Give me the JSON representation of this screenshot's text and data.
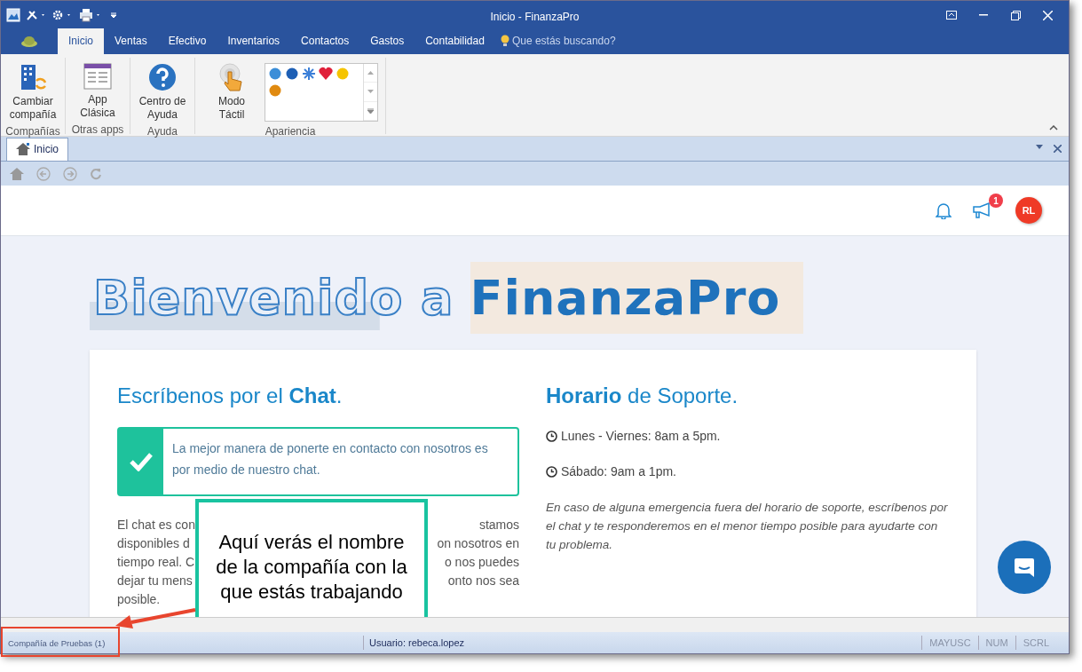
{
  "window": {
    "title": "Inicio - FinanzaPro"
  },
  "ribbon_tabs": [
    {
      "label": "Inicio",
      "selected": true
    },
    {
      "label": "Ventas",
      "selected": false
    },
    {
      "label": "Efectivo",
      "selected": false
    },
    {
      "label": "Inventarios",
      "selected": false
    },
    {
      "label": "Contactos",
      "selected": false
    },
    {
      "label": "Gastos",
      "selected": false
    },
    {
      "label": "Contabilidad",
      "selected": false
    }
  ],
  "search": {
    "placeholder": "Que estás buscando?"
  },
  "ribbon_groups": [
    {
      "label": "Compañías",
      "kind": "buttons",
      "buttons": [
        {
          "label": "Cambiar compañía",
          "kind": "building"
        }
      ]
    },
    {
      "label": "Otras apps",
      "kind": "buttons",
      "buttons": [
        {
          "label": "App Clásica",
          "kind": "window"
        }
      ]
    },
    {
      "label": "Ayuda",
      "kind": "buttons",
      "buttons": [
        {
          "label": "Centro de Ayuda",
          "kind": "help"
        }
      ]
    },
    {
      "label": "Apariencia",
      "kind": "gallery",
      "buttons": [
        {
          "label": "Modo Táctil",
          "kind": "touch"
        }
      ]
    }
  ],
  "document_tabs": [
    {
      "label": "Inicio",
      "selected": true
    }
  ],
  "header": {
    "notification_count": "1",
    "avatar_initials": "RL"
  },
  "welcome": {
    "lead": "Bienvenido a",
    "brand": "FinanzaPro"
  },
  "chat_section": {
    "heading": "Escríbenos por el **Chat**.",
    "alert": "La mejor manera de ponerte en contacto con nosotros es por medio de nuestro chat.",
    "paragraph_lines": [
      {
        "left": "El chat es con",
        "right": "stamos"
      },
      {
        "left": "disponibles d",
        "right": "on nosotros en"
      },
      {
        "left": "tiempo real. C",
        "right": "o nos puedes"
      },
      {
        "left": "dejar tu mens",
        "right": "onto nos sea"
      },
      {
        "left": "posible."
      }
    ]
  },
  "support_section": {
    "heading": "**Horario** de Soporte.",
    "hours": [
      "Lunes - Viernes: 8am a 5pm.",
      "Sábado: 9am a 1pm."
    ],
    "note": "En caso de alguna emergencia fuera del horario de soporte, escríbenos por el chat y te responderemos en el menor tiempo posible para ayudarte con tu problema."
  },
  "callout": {
    "text": "Aquí verás el nombre de la compañía con la que estás trabajando"
  },
  "status_bar": {
    "company": "Compañía de Pruebas (1)",
    "user": "Usuario: rebeca.lopez",
    "indicators": [
      "MAYUSC",
      "NUM",
      "SCRL"
    ]
  }
}
